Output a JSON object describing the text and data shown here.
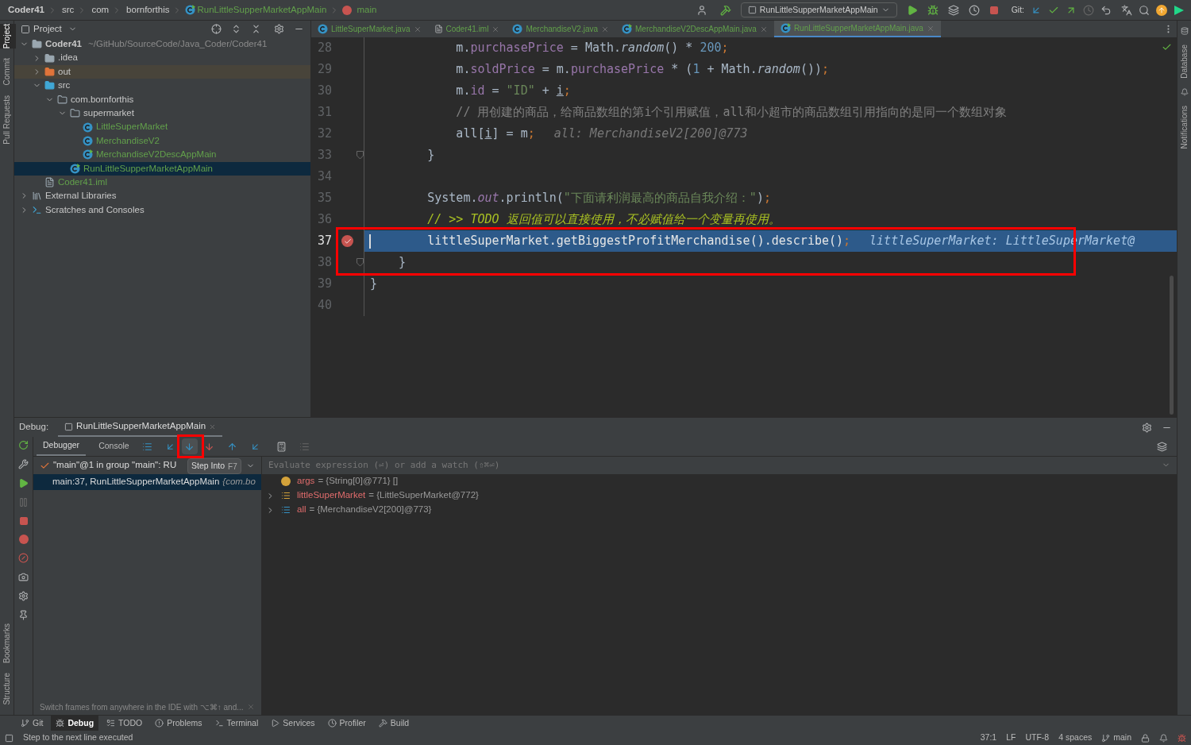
{
  "breadcrumb": [
    {
      "text": "Coder41",
      "kind": "project"
    },
    {
      "text": "src",
      "kind": "folder"
    },
    {
      "text": "com",
      "kind": "folder"
    },
    {
      "text": "bornforthis",
      "kind": "folder"
    },
    {
      "text": "RunLittleSupperMarketAppMain",
      "kind": "class"
    },
    {
      "text": "main",
      "kind": "method"
    }
  ],
  "run_config": "RunLittleSupperMarketAppMain",
  "git_label": "Git:",
  "left_strip_top": [
    {
      "label": "Project",
      "selected": true
    },
    {
      "label": "Commit",
      "selected": false
    },
    {
      "label": "Pull Requests",
      "selected": false
    }
  ],
  "left_strip_bottom": [
    {
      "label": "Bookmarks",
      "selected": false
    },
    {
      "label": "Structure",
      "selected": false
    }
  ],
  "right_strip": [
    {
      "label": "Database"
    },
    {
      "label": "Notifications"
    }
  ],
  "project": {
    "title": "Project",
    "tree": [
      {
        "name": "Coder41",
        "path": "~/GitHub/SourceCode/Java_Coder/Coder41",
        "kind": "module",
        "expanded": true,
        "selected": false,
        "children": [
          {
            "name": ".idea",
            "kind": "folder",
            "expanded": false,
            "selected": false
          },
          {
            "name": "out",
            "kind": "excluded",
            "expanded": false,
            "selected": false
          },
          {
            "name": "src",
            "kind": "source",
            "expanded": true,
            "selected": false,
            "children": [
              {
                "name": "com.bornforthis",
                "kind": "package",
                "expanded": true,
                "selected": false,
                "children": [
                  {
                    "name": "supermarket",
                    "kind": "package",
                    "expanded": true,
                    "selected": false,
                    "children": [
                      {
                        "name": "LittleSuperMarket",
                        "kind": "class",
                        "selected": false
                      },
                      {
                        "name": "MerchandiseV2",
                        "kind": "class",
                        "selected": false
                      },
                      {
                        "name": "MerchandiseV2DescAppMain",
                        "kind": "runclass",
                        "selected": false
                      }
                    ]
                  },
                  {
                    "name": "RunLittleSupperMarketAppMain",
                    "kind": "runclass",
                    "selected": true
                  }
                ]
              }
            ]
          },
          {
            "name": "Coder41.iml",
            "kind": "iml",
            "selected": false
          }
        ]
      },
      {
        "name": "External Libraries",
        "kind": "libraries",
        "expanded": false,
        "selected": false
      },
      {
        "name": "Scratches and Consoles",
        "kind": "scratches",
        "expanded": false,
        "selected": false
      }
    ]
  },
  "editor": {
    "tabs": [
      {
        "label": "LittleSuperMarket.java",
        "kind": "class",
        "selected": false
      },
      {
        "label": "Coder41.iml",
        "kind": "iml",
        "selected": false
      },
      {
        "label": "MerchandiseV2.java",
        "kind": "class",
        "selected": false
      },
      {
        "label": "MerchandiseV2DescAppMain.java",
        "kind": "runclass",
        "selected": false
      },
      {
        "label": "RunLittleSupperMarketAppMain.java",
        "kind": "runclass",
        "selected": true
      }
    ],
    "lines": [
      {
        "number": "28",
        "current": false,
        "breakpoint": false,
        "fold": false,
        "segments": [
          {
            "text": "            m.",
            "kind": "plain"
          },
          {
            "text": "purchasePrice",
            "kind": "field"
          },
          {
            "text": " = Math.",
            "kind": "plain"
          },
          {
            "text": "random",
            "kind": "italic"
          },
          {
            "text": "() * ",
            "kind": "plain"
          },
          {
            "text": "200",
            "kind": "number"
          },
          {
            "text": ";",
            "kind": "keyword"
          }
        ]
      },
      {
        "number": "29",
        "current": false,
        "breakpoint": false,
        "fold": false,
        "segments": [
          {
            "text": "            m.",
            "kind": "plain"
          },
          {
            "text": "soldPrice",
            "kind": "field"
          },
          {
            "text": " = m.",
            "kind": "plain"
          },
          {
            "text": "purchasePrice",
            "kind": "field"
          },
          {
            "text": " * (",
            "kind": "plain"
          },
          {
            "text": "1",
            "kind": "number"
          },
          {
            "text": " + Math.",
            "kind": "plain"
          },
          {
            "text": "random",
            "kind": "italic"
          },
          {
            "text": "())",
            "kind": "plain"
          },
          {
            "text": ";",
            "kind": "keyword"
          }
        ]
      },
      {
        "number": "30",
        "current": false,
        "breakpoint": false,
        "fold": false,
        "segments": [
          {
            "text": "            m.",
            "kind": "plain"
          },
          {
            "text": "id",
            "kind": "field"
          },
          {
            "text": " = ",
            "kind": "plain"
          },
          {
            "text": "\"ID\"",
            "kind": "string"
          },
          {
            "text": " + ",
            "kind": "plain"
          },
          {
            "text": "i",
            "kind": "underline"
          },
          {
            "text": ";",
            "kind": "keyword"
          }
        ]
      },
      {
        "number": "31",
        "current": false,
        "breakpoint": false,
        "fold": false,
        "segments": [
          {
            "text": "            // 用创建的商品，给商品数组的第i个引用赋值，all和小超市的商品数组引用指向的是同一个数组对象",
            "kind": "comment"
          }
        ]
      },
      {
        "number": "32",
        "current": false,
        "breakpoint": false,
        "fold": false,
        "segments": [
          {
            "text": "            all[",
            "kind": "plain"
          },
          {
            "text": "i",
            "kind": "underline"
          },
          {
            "text": "] = m",
            "kind": "plain"
          },
          {
            "text": ";",
            "kind": "keyword"
          },
          {
            "text": "all: MerchandiseV2[200]@773",
            "kind": "hint"
          }
        ]
      },
      {
        "number": "33",
        "current": false,
        "breakpoint": false,
        "fold": true,
        "segments": [
          {
            "text": "        }",
            "kind": "plain"
          }
        ]
      },
      {
        "number": "34",
        "current": false,
        "breakpoint": false,
        "fold": false
      },
      {
        "number": "35",
        "current": false,
        "breakpoint": false,
        "fold": false,
        "segments": [
          {
            "text": "        System.",
            "kind": "plain"
          },
          {
            "text": "out",
            "kind": "static"
          },
          {
            "text": ".println(",
            "kind": "plain"
          },
          {
            "text": "\"下面请利润最高的商品自我介绍：\"",
            "kind": "string"
          },
          {
            "text": ")",
            "kind": "plain"
          },
          {
            "text": ";",
            "kind": "keyword"
          }
        ]
      },
      {
        "number": "36",
        "current": false,
        "breakpoint": false,
        "fold": false,
        "segments": [
          {
            "text": "        // >> TODO 返回值可以直接使用，不必赋值给一个变量再使用。",
            "kind": "todo"
          }
        ]
      },
      {
        "number": "37",
        "current": true,
        "breakpoint": true,
        "fold": false,
        "segments": [
          {
            "text": "        littleSuperMarket.getBiggestProfitMerchandise().describe()",
            "kind": "plain"
          },
          {
            "text": ";",
            "kind": "keyword"
          },
          {
            "text": "littleSuperMarket: LittleSuperMarket@",
            "kind": "hint"
          }
        ]
      },
      {
        "number": "38",
        "current": false,
        "breakpoint": false,
        "fold": true,
        "segments": [
          {
            "text": "    }",
            "kind": "plain"
          }
        ]
      },
      {
        "number": "39",
        "current": false,
        "breakpoint": false,
        "fold": false,
        "segments": [
          {
            "text": "}",
            "kind": "plain"
          }
        ]
      },
      {
        "number": "40",
        "current": false,
        "breakpoint": false,
        "fold": false
      }
    ]
  },
  "debug": {
    "label": "Debug:",
    "session": "RunLittleSupperMarketAppMain",
    "tabs": [
      {
        "label": "Debugger",
        "selected": true
      },
      {
        "label": "Console",
        "selected": false
      }
    ],
    "tooltip": {
      "label": "Step Into",
      "shortcut": "F7"
    },
    "thread": "\"main\"@1 in group \"main\": RU",
    "frames": [
      {
        "text": "main:37, RunLittleSupperMarketAppMain",
        "extra": "{com.bo",
        "selected": true
      }
    ],
    "frames_hint": "Switch frames from anywhere in the IDE with ⌥⌘↑ and...",
    "evaluate_placeholder": "Evaluate expression (⏎) or add a watch (⇧⌘⏎)",
    "variables": [
      {
        "name": "args",
        "value": "= {String[0]@771} []",
        "kind": "param"
      },
      {
        "name": "littleSuperMarket",
        "value": "= {LittleSuperMarket@772}",
        "kind": "object",
        "expanded": false
      },
      {
        "name": "all",
        "value": "= {MerchandiseV2[200]@773}",
        "kind": "array",
        "expanded": false
      }
    ]
  },
  "tool_windows": [
    {
      "label": "Git",
      "selected": false
    },
    {
      "label": "Debug",
      "selected": true
    },
    {
      "label": "TODO",
      "selected": false
    },
    {
      "label": "Problems",
      "selected": false
    },
    {
      "label": "Terminal",
      "selected": false
    },
    {
      "label": "Services",
      "selected": false
    },
    {
      "label": "Profiler",
      "selected": false
    },
    {
      "label": "Build",
      "selected": false
    }
  ],
  "status": {
    "message": "Step to the next line executed",
    "position": "37:1",
    "line_sep": "LF",
    "encoding": "UTF-8",
    "indent": "4 spaces",
    "branch": "main"
  }
}
